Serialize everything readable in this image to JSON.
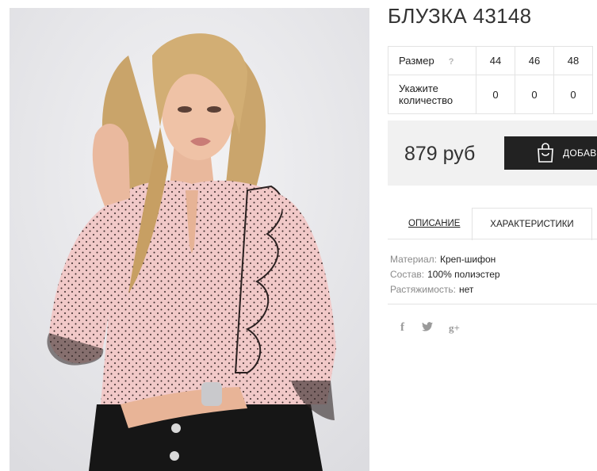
{
  "product": {
    "title": "БЛУЗКА 43148",
    "photo_alt": "Блузка 43148"
  },
  "sizes": {
    "size_label": "Размер",
    "help_icon": "?",
    "qty_label_line1": "Укажите",
    "qty_label_line2": "количество",
    "columns": [
      {
        "size": "44",
        "qty": "0"
      },
      {
        "size": "46",
        "qty": "0"
      },
      {
        "size": "48",
        "qty": "0"
      }
    ]
  },
  "price": {
    "value": "879 руб",
    "add_button": "ДОБАВИ",
    "add_icon": "shopping-bag-icon"
  },
  "tabs": {
    "description": "ОПИСАНИЕ",
    "characteristics": "ХАРАКТЕРИСТИКИ",
    "active": "characteristics"
  },
  "properties": [
    {
      "key": "Материал:",
      "value": "Креп-шифон"
    },
    {
      "key": "Состав:",
      "value": "100% полиэстер"
    },
    {
      "key": "Растяжимость:",
      "value": "нет"
    }
  ],
  "social": {
    "facebook": "f",
    "google_plus": "g+",
    "icons": [
      "facebook-icon",
      "twitter-icon",
      "google-plus-icon"
    ]
  },
  "colors": {
    "button_bg": "#222222",
    "price_bg": "#f1f1f1",
    "border": "#e3e3e3",
    "muted": "#8a8a8a"
  }
}
